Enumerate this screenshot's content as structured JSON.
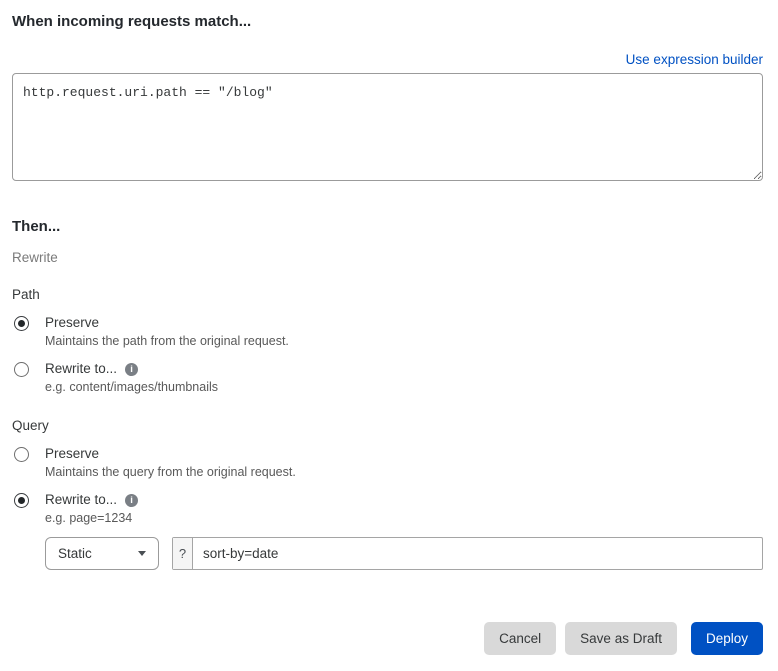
{
  "match_section": {
    "heading": "When incoming requests match...",
    "expression_builder_link": "Use expression builder",
    "expression_value": "http.request.uri.path == \"/blog\""
  },
  "then_section": {
    "heading": "Then...",
    "action_label": "Rewrite",
    "path_group": {
      "label": "Path",
      "options": [
        {
          "label": "Preserve",
          "description": "Maintains the path from the original request.",
          "checked": true,
          "has_info": false
        },
        {
          "label": "Rewrite to...",
          "description": "e.g. content/images/thumbnails",
          "checked": false,
          "has_info": true
        }
      ]
    },
    "query_group": {
      "label": "Query",
      "options": [
        {
          "label": "Preserve",
          "description": "Maintains the query from the original request.",
          "checked": false,
          "has_info": false
        },
        {
          "label": "Rewrite to...",
          "description": "e.g. page=1234",
          "checked": true,
          "has_info": true
        }
      ]
    },
    "rewrite_value_row": {
      "type_select_value": "Static",
      "prefix": "?",
      "input_value": "sort-by=date"
    }
  },
  "footer": {
    "cancel_label": "Cancel",
    "save_draft_label": "Save as Draft",
    "deploy_label": "Deploy"
  },
  "icons": {
    "info_glyph": "i"
  },
  "colors": {
    "accent_blue": "#0051c3",
    "button_gray": "#d9d9d9",
    "subtext_gray": "#595959"
  }
}
